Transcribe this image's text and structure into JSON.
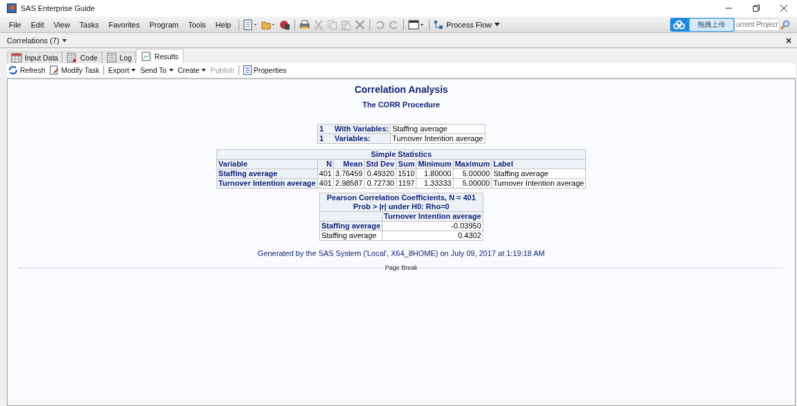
{
  "window": {
    "title": "SAS Enterprise Guide"
  },
  "menu": [
    "File",
    "Edit",
    "View",
    "Tasks",
    "Favorites",
    "Program",
    "Tools",
    "Help"
  ],
  "process_flow": {
    "label": "Process Flow"
  },
  "upload": {
    "label": "拖拽上传"
  },
  "search": {
    "placeholder": "urrent Project"
  },
  "project_tab": {
    "label": "Correlations (7)"
  },
  "tabs": [
    {
      "label": "Input Data",
      "kind": "data",
      "selected": false
    },
    {
      "label": "Code",
      "kind": "code",
      "selected": false
    },
    {
      "label": "Log",
      "kind": "log",
      "selected": false
    },
    {
      "label": "Results",
      "kind": "results",
      "selected": true
    }
  ],
  "results_toolbar": [
    [
      {
        "label": "Refresh",
        "kind": "refresh",
        "disabled": false
      },
      {
        "label": "Modify Task",
        "kind": "modify",
        "disabled": false
      }
    ],
    [
      {
        "label": "Export",
        "kind": "menu",
        "disabled": false
      },
      {
        "label": "Send To",
        "kind": "menu",
        "disabled": false
      },
      {
        "label": "Create",
        "kind": "menu",
        "disabled": false
      },
      {
        "label": "Publish",
        "kind": "plain",
        "disabled": true
      }
    ],
    [
      {
        "label": "Properties",
        "kind": "properties",
        "disabled": false
      }
    ]
  ],
  "report": {
    "title": "Correlation Analysis",
    "subtitle": "The CORR Procedure",
    "variables_table": [
      {
        "count": "1",
        "label": "With Variables:",
        "value": "Staffing average"
      },
      {
        "count": "1",
        "label": "Variables:",
        "value": "Turnover Intention average"
      }
    ],
    "simple_statistics": {
      "title": "Simple Statistics",
      "columns": [
        "Variable",
        "N",
        "Mean",
        "Std Dev",
        "Sum",
        "Minimum",
        "Maximum",
        "Label"
      ],
      "rows": [
        [
          "Staffing average",
          "401",
          "3.76459",
          "0.49320",
          "1510",
          "1.80000",
          "5.00000",
          "Staffing average"
        ],
        [
          "Turnover Intention average",
          "401",
          "2.98587",
          "0.72730",
          "1197",
          "1.33333",
          "5.00000",
          "Turnover Intention average"
        ]
      ]
    },
    "pearson": {
      "title": "Pearson Correlation Coefficients, N = 401",
      "subtitle": "Prob > |r| under H0: Rho=0",
      "column": "Turnover Intention average",
      "rows": [
        {
          "label": "Staffing average",
          "value": "-0.03950",
          "bold": true
        },
        {
          "label": "Staffing average",
          "value": "0.4302",
          "bold": false
        }
      ]
    },
    "footer": "Generated by the SAS System ('Local', X64_8HOME) on July 09, 2017 at 1:19:18 AM",
    "page_break": "Page Break"
  }
}
